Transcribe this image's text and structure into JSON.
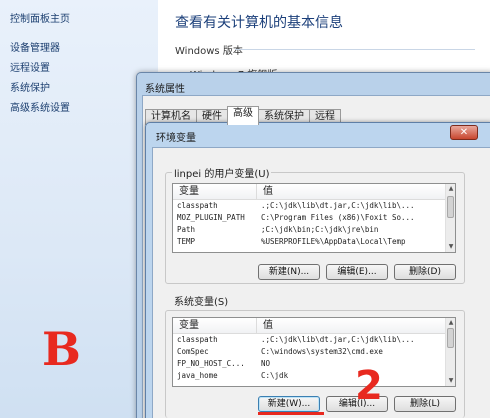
{
  "control_panel": {
    "home_link": "控制面板主页",
    "nav_links": [
      "设备管理器",
      "远程设置",
      "系统保护",
      "高级系统设置"
    ],
    "title": "查看有关计算机的基本信息",
    "windows_version_label": "Windows 版本",
    "windows_edition": "Windows 7 旗舰版"
  },
  "system_properties": {
    "title": "系统属性",
    "tabs": [
      "计算机名",
      "硬件",
      "高级",
      "系统保护",
      "远程"
    ],
    "active_tab": "高级"
  },
  "env_dialog": {
    "title": "环境变量",
    "close_icon": "close-icon",
    "close_glyph": "✕",
    "user_vars": {
      "label": "linpei 的用户变量(U)",
      "columns": [
        "变量",
        "值"
      ],
      "rows": [
        {
          "name": "classpath",
          "value": ".;C:\\jdk\\lib\\dt.jar,C:\\jdk\\lib\\..."
        },
        {
          "name": "MOZ_PLUGIN_PATH",
          "value": "C:\\Program Files (x86)\\Foxit So..."
        },
        {
          "name": "Path",
          "value": ";C:\\jdk\\bin;C:\\jdk\\jre\\bin"
        },
        {
          "name": "TEMP",
          "value": "%USERPROFILE%\\AppData\\Local\\Temp"
        }
      ],
      "buttons": {
        "new": "新建(N)...",
        "edit": "编辑(E)...",
        "delete": "删除(D)"
      }
    },
    "system_vars": {
      "label": "系统变量(S)",
      "columns": [
        "变量",
        "值"
      ],
      "rows": [
        {
          "name": "classpath",
          "value": ".;C:\\jdk\\lib\\dt.jar,C:\\jdk\\lib\\..."
        },
        {
          "name": "ComSpec",
          "value": "C:\\windows\\system32\\cmd.exe"
        },
        {
          "name": "FP_NO_HOST_C...",
          "value": "NO"
        },
        {
          "name": "java_home",
          "value": "C:\\jdk"
        }
      ],
      "buttons": {
        "new": "新建(W)...",
        "edit": "编辑(I)...",
        "delete": "删除(L)"
      }
    }
  },
  "annotations": {
    "letter": "B",
    "number": "2",
    "color": "#e8291f"
  }
}
